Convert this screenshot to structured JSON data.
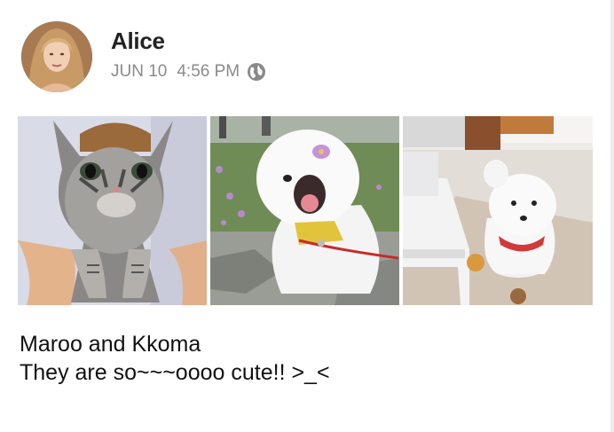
{
  "author": {
    "name": "Alice",
    "avatar_icon": "profile-photo-avatar"
  },
  "post": {
    "date": "JUN 10",
    "time": "4:56 PM",
    "visibility_icon": "globe-icon",
    "caption_line1": "Maroo and Kkoma",
    "caption_line2": "They are so~~~oooo cute!! >_<"
  },
  "photos": [
    {
      "subject": "gray tabby cat"
    },
    {
      "subject": "white bichon dog with flower"
    },
    {
      "subject": "white bichon dog in living room"
    }
  ],
  "colors": {
    "name_text": "#222222",
    "meta_text": "#8a8a8a",
    "caption_text": "#111111"
  }
}
